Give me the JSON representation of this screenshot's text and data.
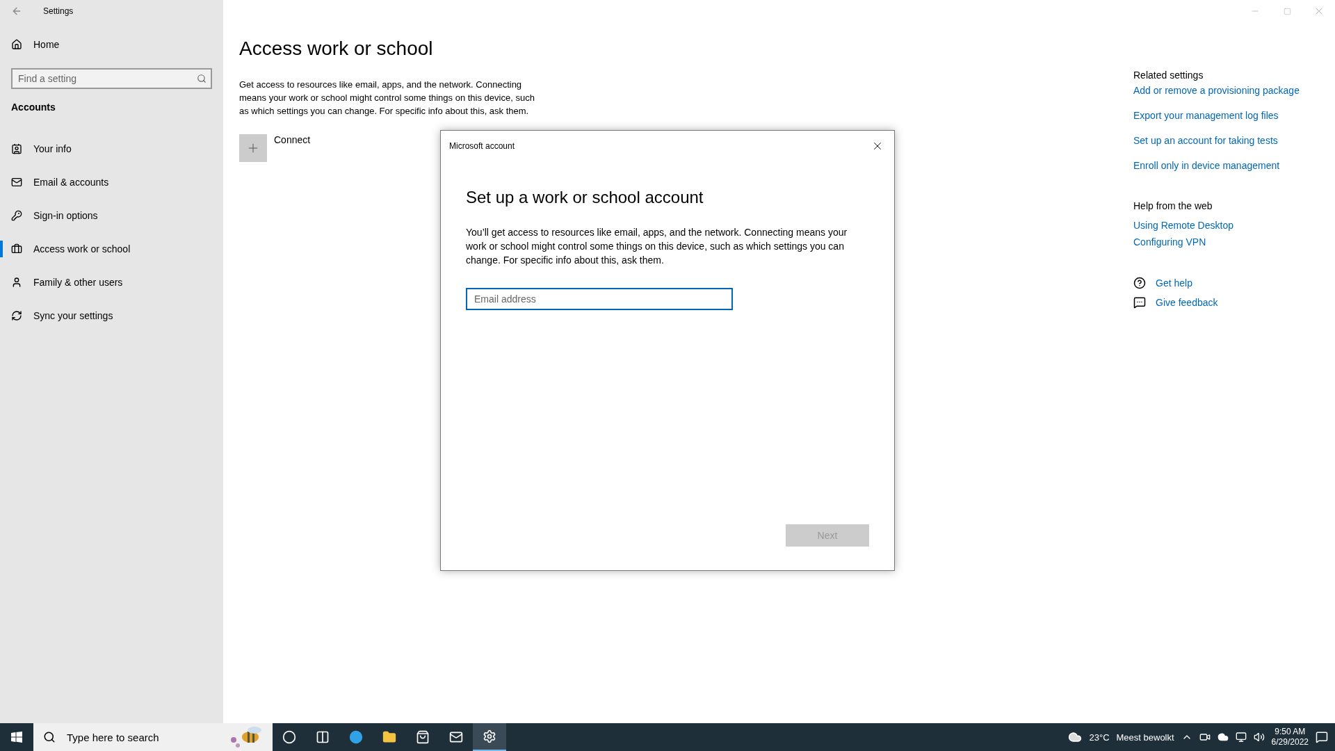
{
  "window": {
    "title": "Settings"
  },
  "sidebar": {
    "home": "Home",
    "search": {
      "placeholder": "Find a setting"
    },
    "section": "Accounts",
    "items": [
      {
        "label": "Your info",
        "kind": "info",
        "selected": false
      },
      {
        "label": "Email & accounts",
        "kind": "mail",
        "selected": false
      },
      {
        "label": "Sign-in options",
        "kind": "key",
        "selected": false
      },
      {
        "label": "Access work or school",
        "kind": "briefcase",
        "selected": true
      },
      {
        "label": "Family & other users",
        "kind": "user",
        "selected": false
      },
      {
        "label": "Sync your settings",
        "kind": "sync",
        "selected": false
      }
    ]
  },
  "main": {
    "title": "Access work or school",
    "description": "Get access to resources like email, apps, and the network. Connecting means your work or school might control some things on this device, such as which settings you can change. For specific info about this, ask them.",
    "connect": "Connect"
  },
  "related": {
    "title": "Related settings",
    "links": [
      "Add or remove a provisioning package",
      "Export your management log files",
      "Set up an account for taking tests",
      "Enroll only in device management"
    ]
  },
  "help_web": {
    "title": "Help from the web",
    "links": [
      "Using Remote Desktop",
      "Configuring VPN"
    ]
  },
  "support": [
    {
      "label": "Get help",
      "kind": "help"
    },
    {
      "label": "Give feedback",
      "kind": "feedback"
    }
  ],
  "dialog": {
    "title": "Microsoft account",
    "heading": "Set up a work or school account",
    "body": "You’ll get access to resources like email, apps, and the network. Connecting means your work or school might control some things on this device, such as which settings you can change. For specific info about this, ask them.",
    "email": {
      "placeholder": "Email address"
    },
    "next": {
      "label": "Next",
      "disabled": true
    }
  },
  "taskbar": {
    "search": {
      "placeholder": "Type here to search"
    },
    "apps": [
      {
        "kind": "cortana",
        "selected": false
      },
      {
        "kind": "taskview",
        "selected": false
      },
      {
        "kind": "edge",
        "selected": false
      },
      {
        "kind": "explorer",
        "selected": false
      },
      {
        "kind": "store",
        "selected": false
      },
      {
        "kind": "mail",
        "selected": false
      },
      {
        "kind": "settings",
        "selected": true
      }
    ],
    "weather": {
      "temp": "23°C",
      "condition": "Meest bewolkt"
    },
    "time": "9:50 AM",
    "date": "6/29/2022"
  }
}
